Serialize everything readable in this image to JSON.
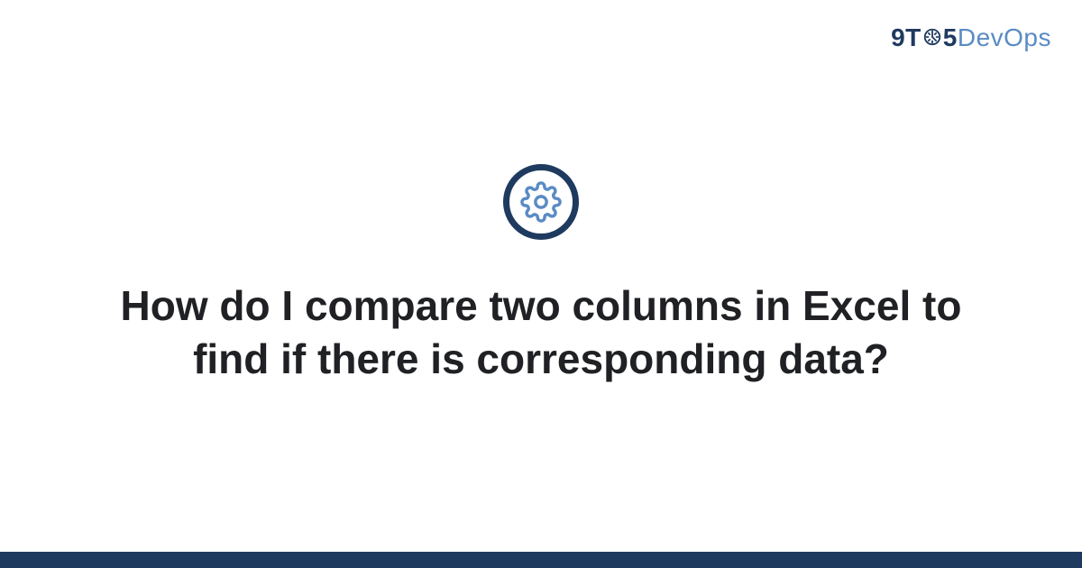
{
  "logo": {
    "part1": "9T",
    "part2": "5",
    "part3": "DevOps"
  },
  "main": {
    "title": "How do I compare two columns in Excel to find if there is corresponding data?"
  },
  "colors": {
    "primary": "#1f3a5f",
    "accent": "#5a8bc4"
  }
}
